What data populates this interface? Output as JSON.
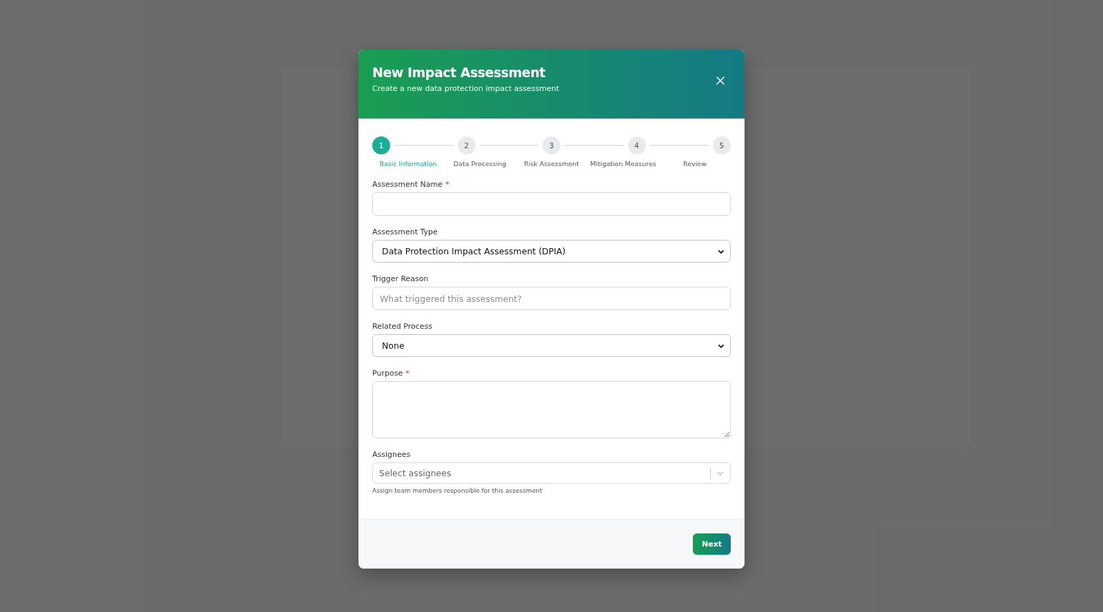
{
  "dialog": {
    "title": "New Impact Assessment",
    "subtitle": "Create a new data protection impact assessment",
    "steps": [
      {
        "number": "1",
        "label": "Basic Information",
        "selected": true
      },
      {
        "number": "2",
        "label": "Data Processing",
        "selected": false
      },
      {
        "number": "3",
        "label": "Risk Assessment",
        "selected": false
      },
      {
        "number": "4",
        "label": "Mitigation Measures",
        "selected": false
      },
      {
        "number": "5",
        "label": "Review",
        "selected": false
      }
    ],
    "fields": [
      {
        "kind": "text",
        "label": "Assessment Name",
        "required_mark": "*"
      },
      {
        "kind": "select",
        "label": "Assessment Type",
        "value": "Data Protection Impact Assessment (DPIA)"
      },
      {
        "kind": "text",
        "label": "Trigger Reason",
        "placeholder": "What triggered this assessment?"
      },
      {
        "kind": "select",
        "label": "Related Process",
        "value": "None"
      },
      {
        "kind": "textarea",
        "label": "Purpose",
        "required_mark": "*"
      },
      {
        "kind": "multiselect",
        "label": "Assignees",
        "placeholder": "Select assignees",
        "hint": "Assign team members responsible for this assessment"
      }
    ],
    "buttons": [
      {
        "label": "Next"
      }
    ]
  }
}
